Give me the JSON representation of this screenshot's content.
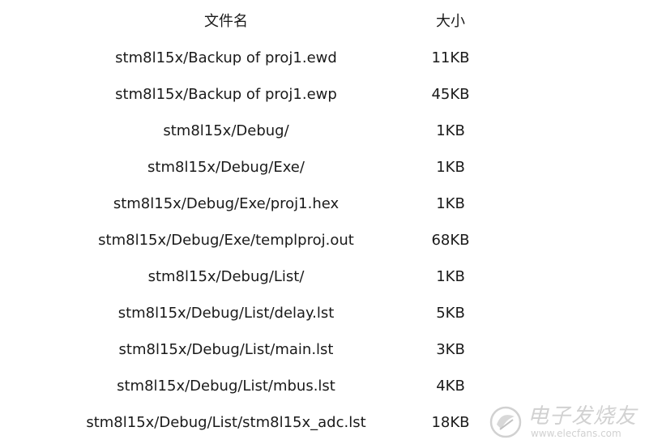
{
  "table": {
    "header": {
      "name": "文件名",
      "size": "大小"
    },
    "rows": [
      {
        "name": "stm8l15x/Backup of proj1.ewd",
        "size": "11KB"
      },
      {
        "name": "stm8l15x/Backup of proj1.ewp",
        "size": "45KB"
      },
      {
        "name": "stm8l15x/Debug/",
        "size": "1KB"
      },
      {
        "name": "stm8l15x/Debug/Exe/",
        "size": "1KB"
      },
      {
        "name": "stm8l15x/Debug/Exe/proj1.hex",
        "size": "1KB"
      },
      {
        "name": "stm8l15x/Debug/Exe/templproj.out",
        "size": "68KB"
      },
      {
        "name": "stm8l15x/Debug/List/",
        "size": "1KB"
      },
      {
        "name": "stm8l15x/Debug/List/delay.lst",
        "size": "5KB"
      },
      {
        "name": "stm8l15x/Debug/List/main.lst",
        "size": "3KB"
      },
      {
        "name": "stm8l15x/Debug/List/mbus.lst",
        "size": "4KB"
      },
      {
        "name": "stm8l15x/Debug/List/stm8l15x_adc.lst",
        "size": "18KB"
      }
    ]
  },
  "watermark": {
    "text_cn": "电子发烧友",
    "text_en": "www.elecfans.com",
    "icon": "elecfans-logo-icon"
  }
}
